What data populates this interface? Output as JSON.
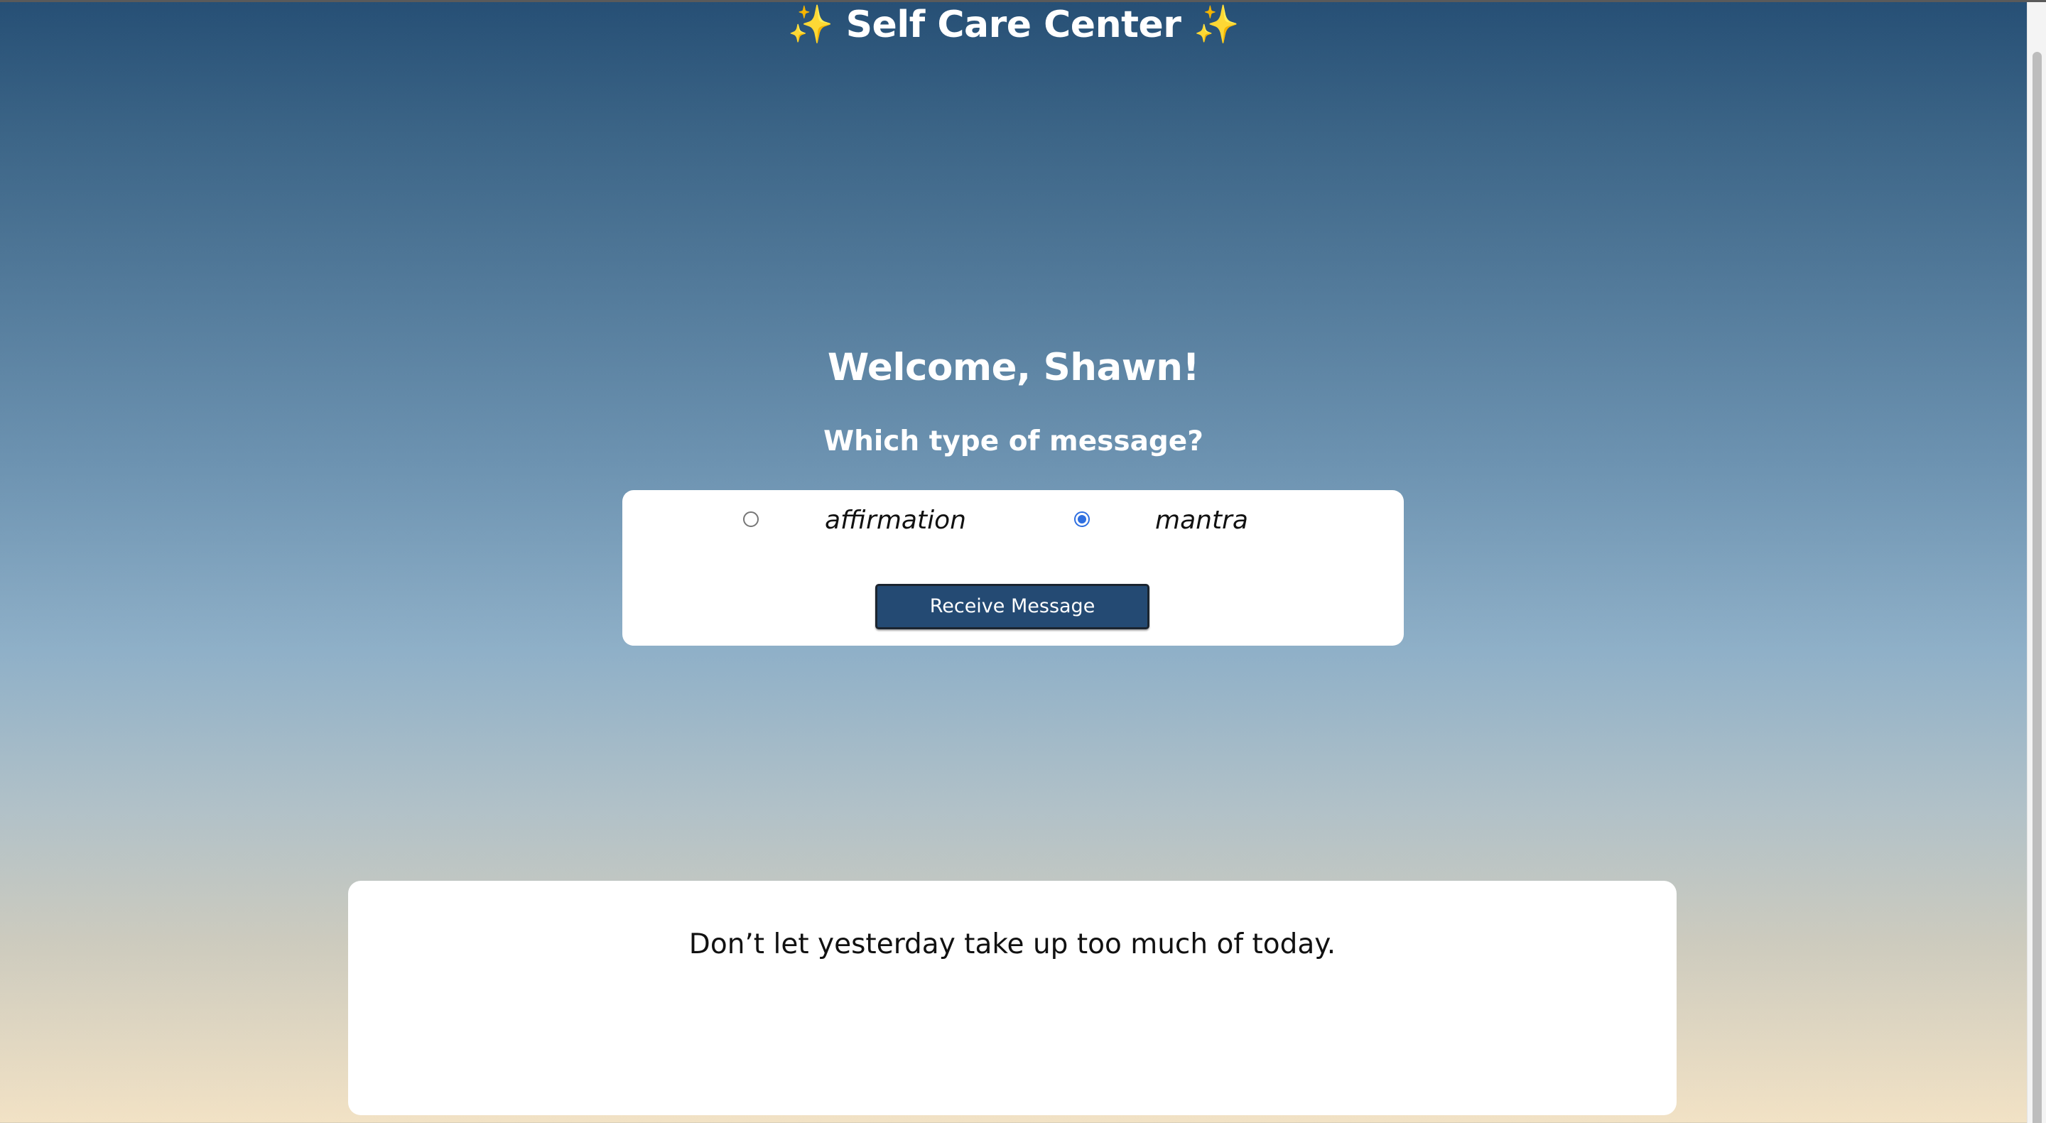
{
  "header": {
    "sparkle_left": "✨",
    "title": "Self Care Center",
    "sparkle_right": "✨"
  },
  "welcome": "Welcome, Shawn!",
  "question": "Which type of message?",
  "options": [
    {
      "label": "affirmation",
      "checked": false
    },
    {
      "label": "mantra",
      "checked": true
    }
  ],
  "receive_button": "Receive Message",
  "message": "Don’t let yesterday take up too much of today.",
  "colors": {
    "accent": "#244a73",
    "radio_checked": "#2f6fe0",
    "sparkle": "#f4c44a"
  }
}
